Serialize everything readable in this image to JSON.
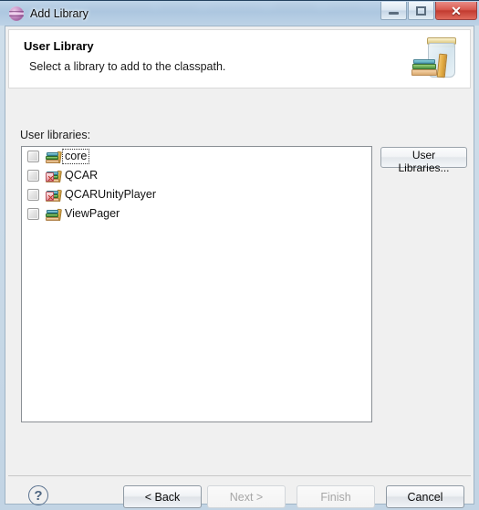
{
  "window": {
    "title": "Add Library",
    "icon": "eclipse-sphere-icon",
    "controls": {
      "minimize_label": "–",
      "maximize_label": "□",
      "close_label": "✕"
    }
  },
  "header": {
    "title": "User Library",
    "description": "Select a library to add to the classpath.",
    "icon": "jar-library-icon"
  },
  "main": {
    "list_label": "User libraries:",
    "libraries": [
      {
        "name": "core",
        "checked": false,
        "icon": "library-icon",
        "focused": true
      },
      {
        "name": "QCAR",
        "checked": false,
        "icon": "library-warning-icon",
        "focused": false
      },
      {
        "name": "QCARUnityPlayer",
        "checked": false,
        "icon": "library-warning-icon",
        "focused": false
      },
      {
        "name": "ViewPager",
        "checked": false,
        "icon": "library-icon",
        "focused": false
      }
    ],
    "user_libraries_button": "User Libraries..."
  },
  "footer": {
    "help_label": "?",
    "buttons": [
      {
        "label": "< Back",
        "enabled": true
      },
      {
        "label": "Next >",
        "enabled": false
      },
      {
        "label": "Finish",
        "enabled": false
      },
      {
        "label": "Cancel",
        "enabled": true
      }
    ]
  },
  "colors": {
    "titlebar_glass": "#c6d9ea",
    "close_button": "#c23b30",
    "client_background": "#f0f0f0",
    "header_background": "#ffffff",
    "list_background": "#ffffff",
    "frame_border": "#9fb4c6"
  }
}
